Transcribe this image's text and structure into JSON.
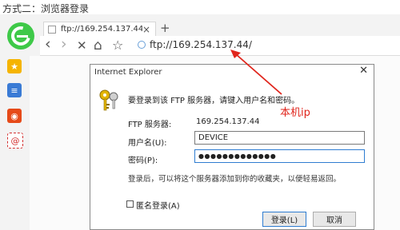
{
  "caption": "方式二：浏览器登录",
  "browser": {
    "tab_title": "ftp://169.254.137.44",
    "tab_close": "×",
    "new_tab": "+",
    "nav": {
      "back": "‹",
      "forward": "›",
      "stop": "✕",
      "home": "⌂",
      "favorite": "☆"
    },
    "url": "ftp://169.254.137.44/"
  },
  "sidebar": [
    {
      "name": "star",
      "symbol": "★",
      "color": "#f5b400"
    },
    {
      "name": "news",
      "symbol": "≡",
      "color": "#3a7bd5"
    },
    {
      "name": "weibo",
      "symbol": "◉",
      "color": "#e64a19"
    },
    {
      "name": "mail",
      "symbol": "@",
      "color": "#d32f2f"
    }
  ],
  "dialog": {
    "title": "Internet Explorer",
    "close": "✕",
    "prompt": "要登录到该 FTP 服务器，请键入用户名和密码。",
    "server_label": "FTP 服务器:",
    "server_value": "169.254.137.44",
    "username_label": "用户名(U):",
    "username_value": "DEVICE",
    "password_label": "密码(P):",
    "password_value": "●●●●●●●●●●●●●",
    "note": "登录后，可以将这个服务器添加到你的收藏夹，以便轻易返回。",
    "anonymous_label": "匿名登录(A)",
    "login_button": "登录(L)",
    "cancel_button": "取消"
  },
  "annotation": "本机ip",
  "colors": {
    "accent": "#2f7dd1",
    "annotation": "#e0251c",
    "logo": "#3ec948"
  }
}
